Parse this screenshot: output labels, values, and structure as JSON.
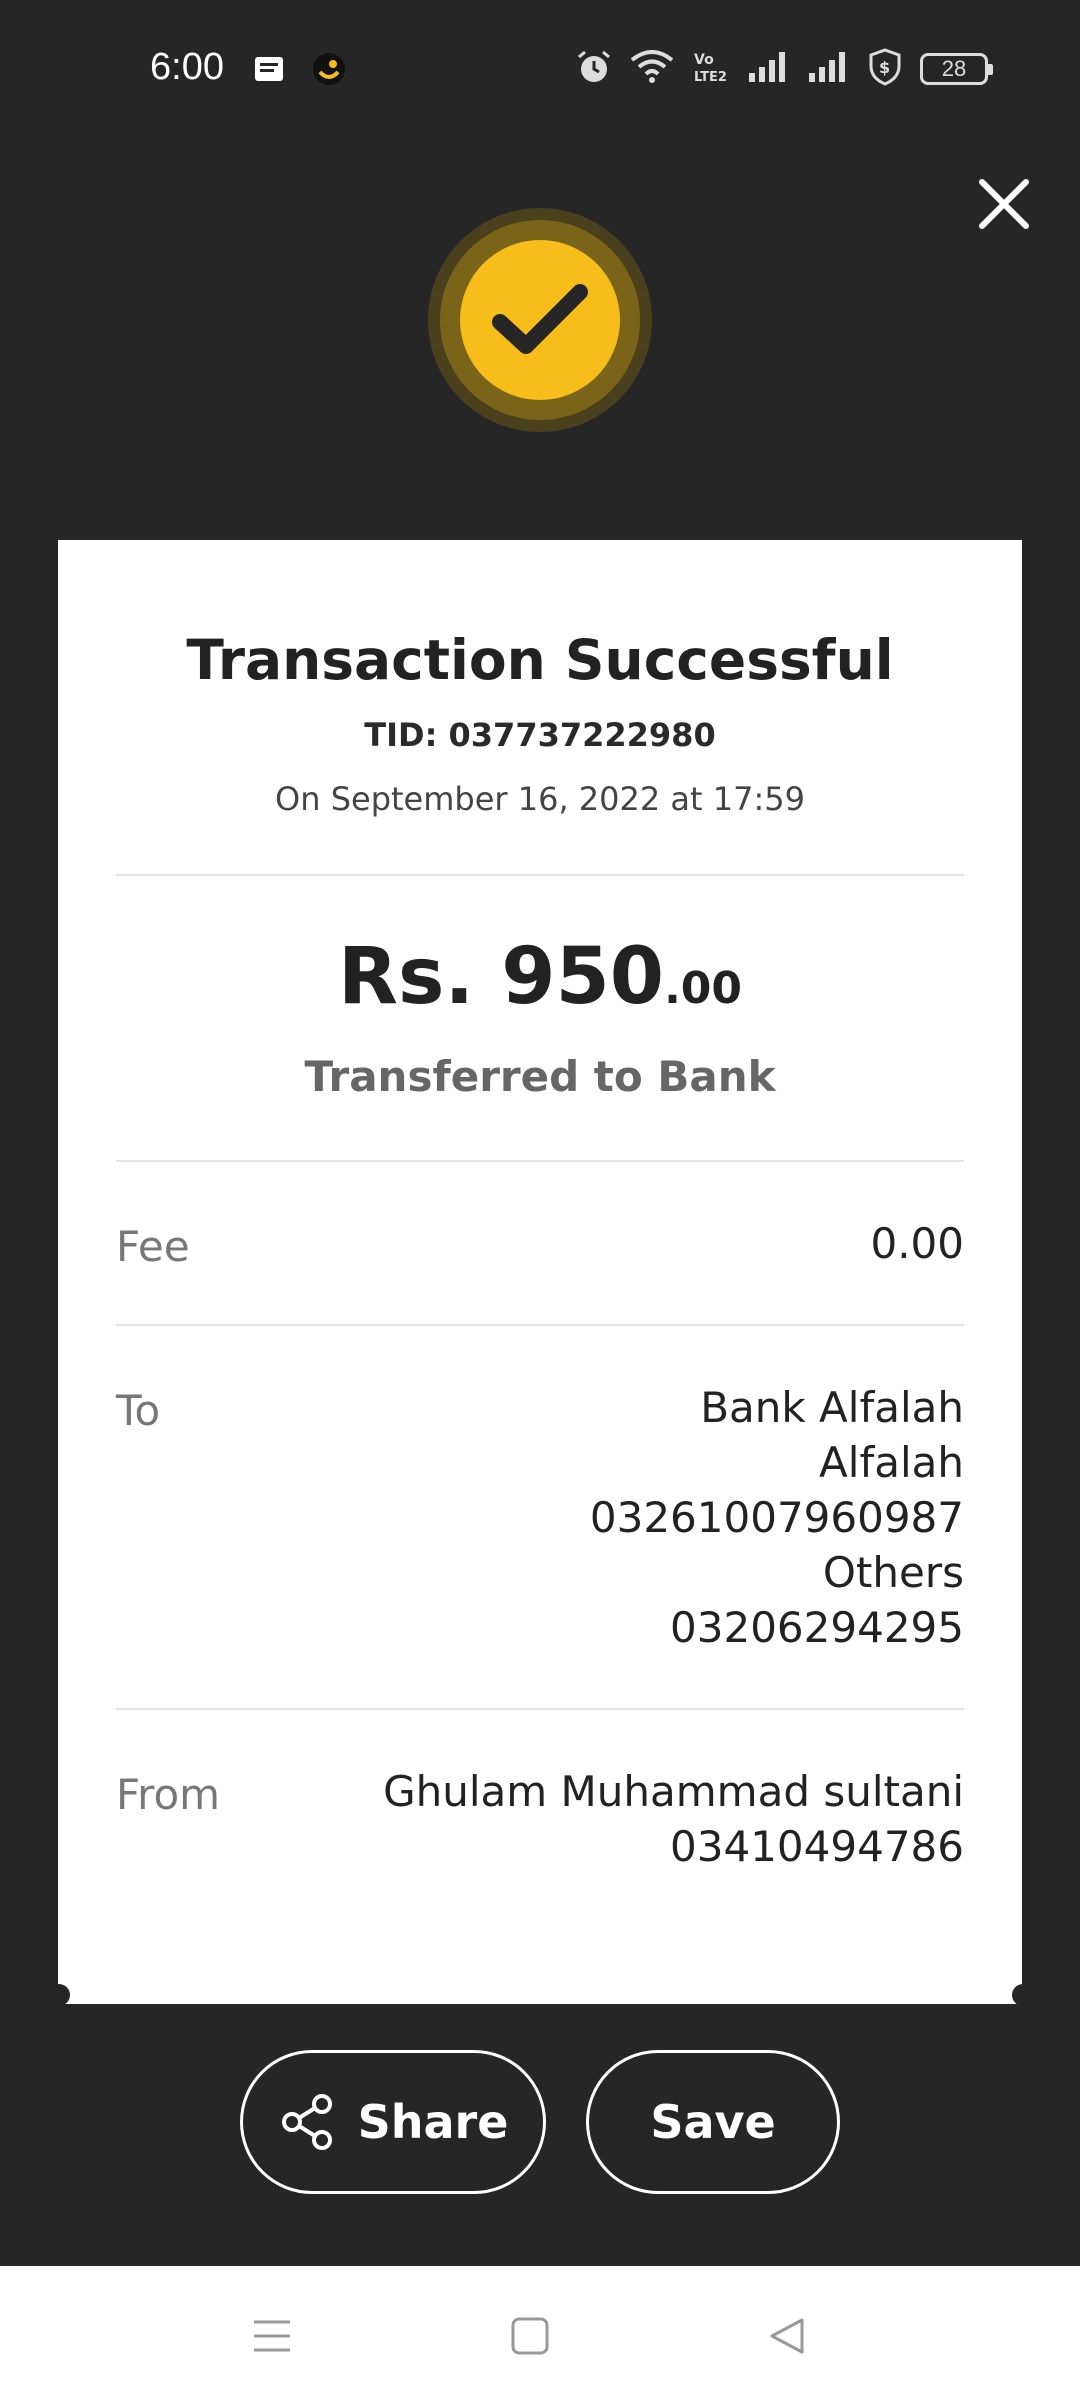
{
  "status_bar": {
    "time": "6:00",
    "battery": "28",
    "icons": [
      "message-icon",
      "app-notification-icon",
      "alarm-icon",
      "wifi-icon",
      "volte-icon",
      "signal-icon",
      "signal-icon",
      "vpn-shield-icon",
      "battery-icon"
    ]
  },
  "receipt": {
    "title": "Transaction Successful",
    "tid": "TID: 037737222980",
    "datetime": "On September 16, 2022 at 17:59",
    "amount_main": "Rs. 950",
    "amount_decimals": ".00",
    "amount_sub": "Transferred to Bank",
    "fee_label": "Fee",
    "fee_value": "0.00",
    "to_label": "To",
    "to_lines": [
      "Bank Alfalah",
      "Alfalah",
      "03261007960987",
      "Others",
      "03206294295"
    ],
    "from_label": "From",
    "from_lines": [
      "Ghulam Muhammad sultani",
      "03410494786"
    ]
  },
  "actions": {
    "share_label": "Share",
    "save_label": "Save"
  },
  "colors": {
    "background": "#262626",
    "accent": "#f7bd1a"
  }
}
